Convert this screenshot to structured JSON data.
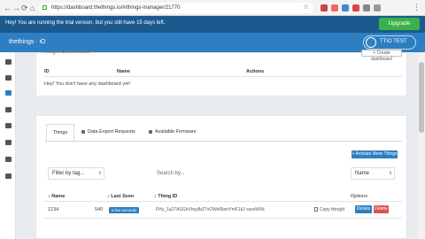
{
  "browser": {
    "url": "https://dashboard.thethings.io/#/things-manager/21770",
    "nav_icons": [
      "back-icon",
      "forward-icon",
      "reload-icon",
      "home-icon"
    ]
  },
  "banner": {
    "text": "Hey! You are running the trial version, but you still have 15 days left.",
    "upgrade_label": "Upgrade"
  },
  "header": {
    "brand": "thethings · iO",
    "user": "TTIO TEST"
  },
  "insight": {
    "title": "Insight Dashboards",
    "create_label": "+ Create dashboard",
    "columns": [
      "ID",
      "Name",
      "Actions"
    ],
    "empty_text": "Hey! You don't have any dashboard yet!"
  },
  "tabs": [
    {
      "label": "Things"
    },
    {
      "label": "Data Export Requests"
    },
    {
      "label": "Available Firmware"
    }
  ],
  "toolbar": {
    "activate_label": "+ Activate More Things",
    "filter_label": "Filter by tag...",
    "search_placeholder": "Search by...",
    "sort_label": "Name"
  },
  "table": {
    "columns": [
      "Name",
      "Last Seen",
      "Thing ID",
      "Options"
    ],
    "rows": [
      {
        "name": "1234",
        "num": "540",
        "last_seen": "a few seconds ago",
        "thing_id": "FHz_1a27ASGhXhuyfbZ7vOWvRbnrYmF1k2 ssssWXk",
        "copy_label": "Copy thingId",
        "details_label": "Details",
        "delete_label": "Delete"
      }
    ]
  },
  "colors": {
    "brand_blue": "#2d7fc1",
    "banner_blue": "#1b5a8f",
    "upgrade_green": "#3bb14a",
    "delete_red": "#d9534f"
  }
}
